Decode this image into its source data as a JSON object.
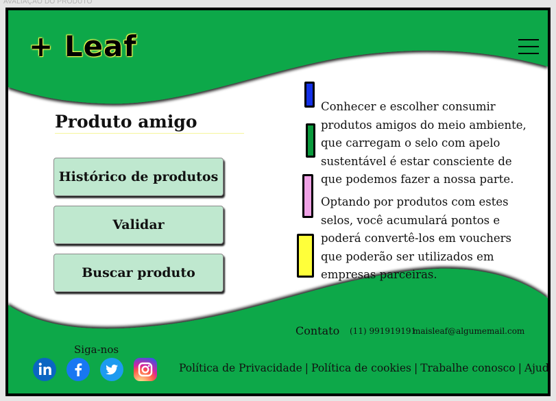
{
  "page_caption": "AVALIAÇÃO DO PRODUTO",
  "header": {
    "logo": "+ Leaf"
  },
  "main": {
    "title": "Produto amigo",
    "buttons": [
      {
        "label": "Histórico de produtos"
      },
      {
        "label": "Validar"
      },
      {
        "label": "Buscar produto"
      }
    ],
    "paragraphs": [
      "Conhecer e escolher consumir produtos amigos do meio ambiente, que carregam o selo com apelo sustentável é estar consciente de que podemos fazer a nossa parte.",
      "Optando por produtos com estes selos, você acumulará pontos e poderá convertê-los em vouchers que poderão ser utilizados em empresas parceiras."
    ],
    "seal_colors": [
      "#1431e8",
      "#0a9a3c",
      "#f0a2e6",
      "#ffff3a"
    ]
  },
  "footer": {
    "contact_label": "Contato",
    "phone": "(11) 991919191",
    "email": "maisleaf@algumemail.com",
    "follow_label": "Siga-nos",
    "social": [
      "linkedin-icon",
      "facebook-icon",
      "twitter-icon",
      "instagram-icon"
    ],
    "links": [
      "Política de Privacidade",
      "Política de cookies",
      "Trabalhe conosco",
      "Ajuda"
    ]
  },
  "colors": {
    "green": "#0ca84a",
    "button_bg": "#bfe8cf",
    "logo_glow": "#f6ff62"
  }
}
